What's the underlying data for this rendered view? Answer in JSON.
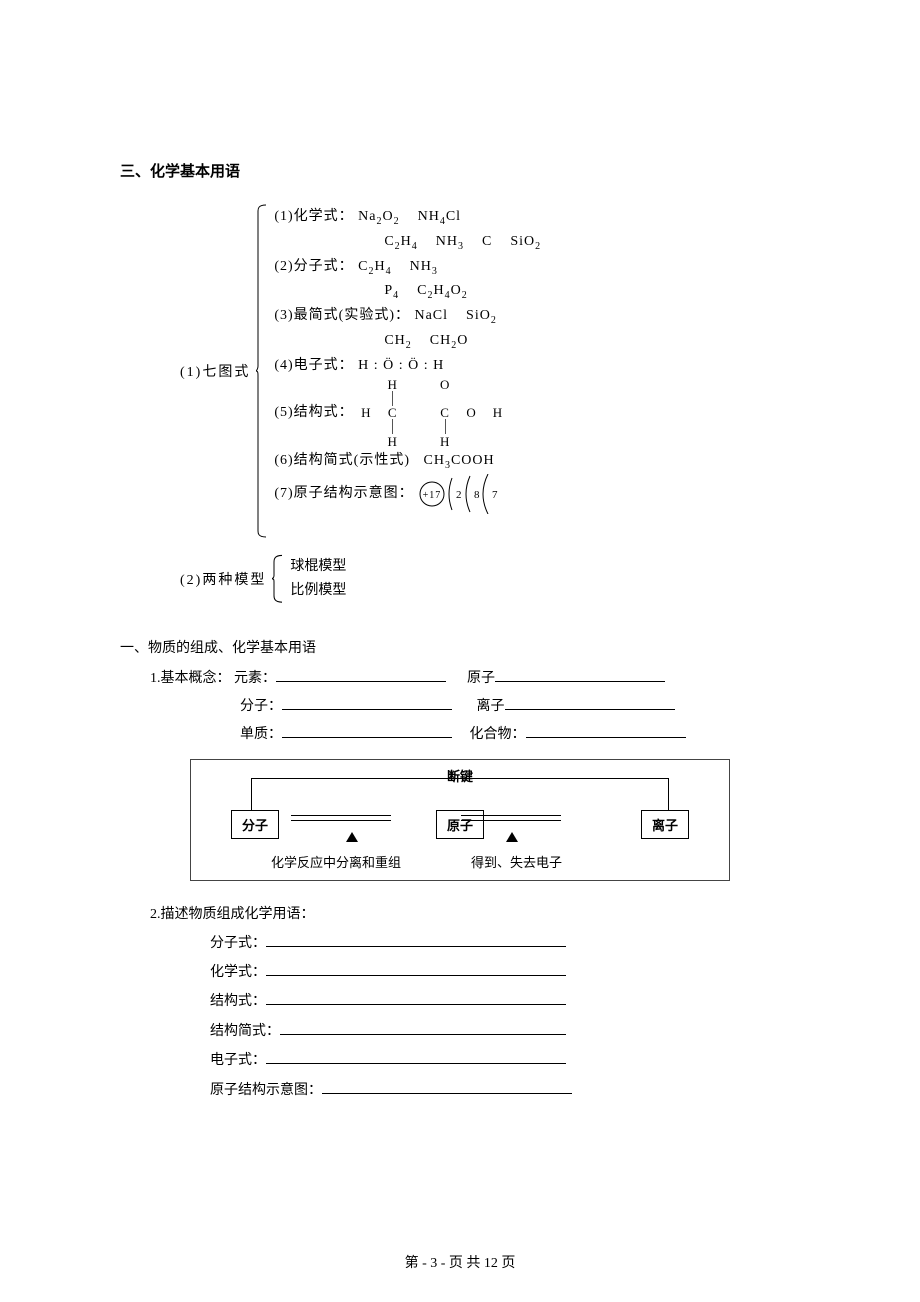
{
  "title": "三、化学基本用语",
  "seven_label": "(1)七图式",
  "seven": {
    "item1_label": "(1)化学式：",
    "item1_ex_a": "Na₂O₂",
    "item1_ex_b": "NH₄Cl",
    "item1_ex_c": "C₂H₄",
    "item1_ex_d": "NH₃",
    "item1_ex_e": "C",
    "item1_ex_f": "SiO₂",
    "item2_label": "(2)分子式：",
    "item2_ex_a": "C₂H₄",
    "item2_ex_b": "NH₃",
    "item2_ex_c": "P₄",
    "item2_ex_d": "C₂H₄O₂",
    "item3_label": "(3)最简式(实验式)：",
    "item3_ex_a": "NaCl",
    "item3_ex_b": "SiO₂",
    "item3_ex_c": "CH₂",
    "item3_ex_d": "CH₂O",
    "item4_label": "(4)电子式：",
    "item4_val_a": "H",
    "item4_val_b": "O",
    "item4_val_c": "O",
    "item4_val_d": "H",
    "item5_label": "(5)结构式：",
    "item5_H": "H",
    "item5_C": "C",
    "item5_O": "O",
    "item6_label": "(6)结构简式(示性式)",
    "item6_val": "CH₃COOH",
    "item7_label": "(7)原子结构示意图：",
    "item7_core": "+17",
    "item7_s1": "2",
    "item7_s2": "8",
    "item7_s3": "7"
  },
  "two_label": "(2)两种模型",
  "two_a": "球棍模型",
  "two_b": "比例模型",
  "sub_title": "一、物质的组成、化学基本用语",
  "concepts_label": "1.基本概念：",
  "c_element": "元素：",
  "c_atom": "原子",
  "c_molecule": "分子：",
  "c_ion": "离子",
  "c_simple": "单质：",
  "c_compound": "化合物：",
  "diagram": {
    "top": "断键",
    "left": "分子",
    "mid": "原子",
    "right": "离子",
    "cap_left": "化学反应中分离和重组",
    "cap_right": "得到、失去电子"
  },
  "desc_label": "2.描述物质组成化学用语：",
  "terms": {
    "t1": "分子式：",
    "t2": "化学式：",
    "t3": "结构式：",
    "t4": "结构简式：",
    "t5": "电子式：",
    "t6": "原子结构示意图："
  },
  "footer": "第 - 3 - 页 共 12 页"
}
